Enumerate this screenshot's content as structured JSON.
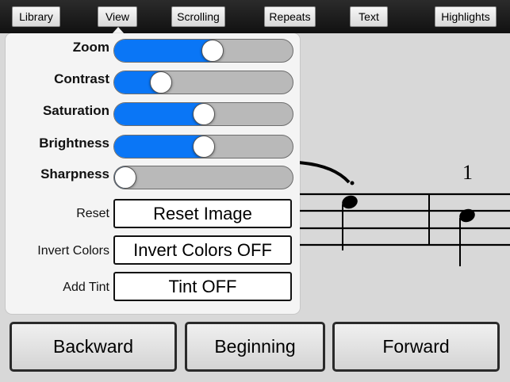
{
  "toolbar": {
    "items": [
      {
        "label": "Library"
      },
      {
        "label": "View"
      },
      {
        "label": "Scrolling"
      },
      {
        "label": "Repeats"
      },
      {
        "label": "Text"
      },
      {
        "label": "Highlights"
      }
    ]
  },
  "view_panel": {
    "sliders": [
      {
        "label": "Zoom",
        "value": 0.56
      },
      {
        "label": "Contrast",
        "value": 0.23
      },
      {
        "label": "Saturation",
        "value": 0.5
      },
      {
        "label": "Brightness",
        "value": 0.5
      },
      {
        "label": "Sharpness",
        "value": 0.0
      }
    ],
    "reset": {
      "label": "Reset",
      "button": "Reset Image"
    },
    "invert": {
      "label": "Invert Colors",
      "button": "Invert Colors OFF"
    },
    "tint": {
      "label": "Add Tint",
      "button": "Tint OFF"
    }
  },
  "music": {
    "measure_number": "1"
  },
  "bottom": {
    "backward": "Backward",
    "beginning": "Beginning",
    "forward": "Forward"
  },
  "colors": {
    "slider_fill": "#0a76f6",
    "track": "#b9b9b9",
    "toolbar": "#1a1a1a"
  }
}
